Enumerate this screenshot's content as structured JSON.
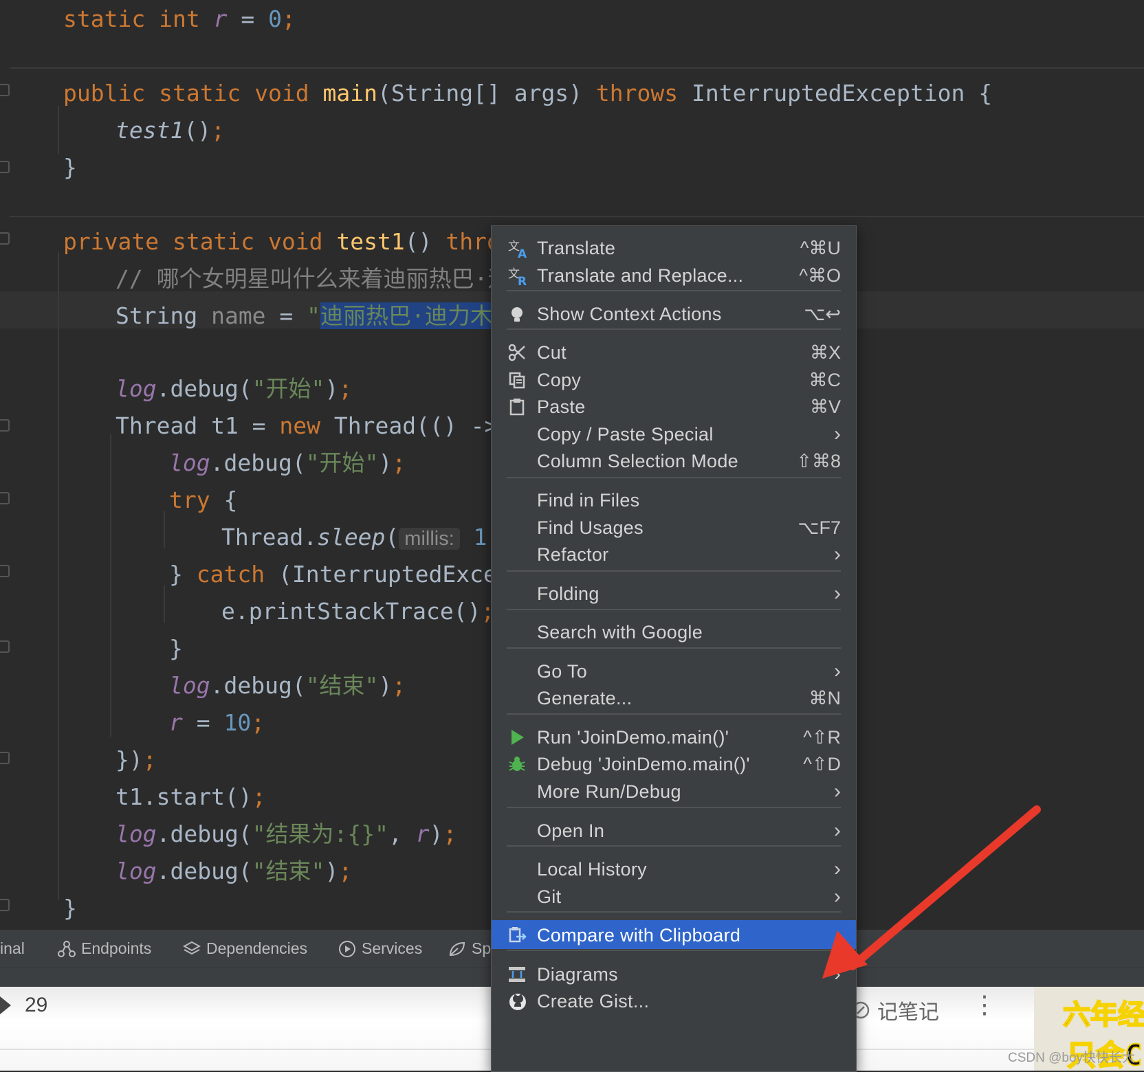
{
  "editor": {
    "lines": [
      {
        "tokens": [
          {
            "t": "static",
            "c": "kw"
          },
          {
            "t": " "
          },
          {
            "t": "int",
            "c": "kw"
          },
          {
            "t": " "
          },
          {
            "t": "r",
            "c": "fld"
          },
          {
            "t": " = "
          },
          {
            "t": "0",
            "c": "num"
          },
          {
            "t": ";",
            "c": "kw"
          }
        ]
      },
      {
        "tokens": [
          {
            "t": "public",
            "c": "kw"
          },
          {
            "t": " "
          },
          {
            "t": "static",
            "c": "kw"
          },
          {
            "t": " "
          },
          {
            "t": "void",
            "c": "kw"
          },
          {
            "t": " "
          },
          {
            "t": "main",
            "c": "fn"
          },
          {
            "t": "(String[] args) "
          },
          {
            "t": "throws",
            "c": "kw"
          },
          {
            "t": " InterruptedException {"
          }
        ]
      },
      {
        "tokens": [
          {
            "t": "test1",
            "c": "ital"
          },
          {
            "t": "()"
          },
          {
            "t": ";",
            "c": "kw"
          }
        ]
      },
      {
        "tokens": [
          {
            "t": "}"
          }
        ]
      },
      {
        "tokens": [
          {
            "t": "private",
            "c": "kw"
          },
          {
            "t": " "
          },
          {
            "t": "static",
            "c": "kw"
          },
          {
            "t": " "
          },
          {
            "t": "void",
            "c": "kw"
          },
          {
            "t": " "
          },
          {
            "t": "test1",
            "c": "fn"
          },
          {
            "t": "() "
          },
          {
            "t": "throw",
            "c": "kw"
          }
        ]
      },
      {
        "tokens": [
          {
            "t": "// 哪个女明星叫什么来着迪丽热巴·迪",
            "c": "cmt"
          }
        ]
      },
      {
        "tokens": [
          {
            "t": "String "
          },
          {
            "t": "name",
            "c": "unused"
          },
          {
            "t": " = "
          },
          {
            "t": "\"",
            "c": "str"
          },
          {
            "t": "迪丽热巴·迪力木拉",
            "c": "str sel"
          }
        ]
      },
      {
        "tokens": [
          {
            "t": "log",
            "c": "fld"
          },
          {
            "t": ".debug("
          },
          {
            "t": "\"开始\"",
            "c": "str"
          },
          {
            "t": ")"
          },
          {
            "t": ";",
            "c": "kw"
          }
        ]
      },
      {
        "tokens": [
          {
            "t": "Thread t1 = "
          },
          {
            "t": "new",
            "c": "kw"
          },
          {
            "t": " Thread(() ->"
          }
        ]
      },
      {
        "tokens": [
          {
            "t": "log",
            "c": "fld"
          },
          {
            "t": ".debug("
          },
          {
            "t": "\"开始\"",
            "c": "str"
          },
          {
            "t": ")"
          },
          {
            "t": ";",
            "c": "kw"
          }
        ]
      },
      {
        "tokens": [
          {
            "t": "try",
            "c": "kw"
          },
          {
            "t": " {"
          }
        ]
      },
      {
        "tokens": [
          {
            "t": "Thread."
          },
          {
            "t": "sleep",
            "c": "ital"
          },
          {
            "t": "("
          },
          {
            "t": "millis:",
            "c": "hint"
          },
          {
            "t": " "
          },
          {
            "t": "1",
            "c": "num"
          },
          {
            "t": ")"
          }
        ]
      },
      {
        "tokens": [
          {
            "t": "} "
          },
          {
            "t": "catch",
            "c": "kw"
          },
          {
            "t": " (InterruptedExcep"
          }
        ]
      },
      {
        "tokens": [
          {
            "t": "e.printStackTrace()"
          },
          {
            "t": ";",
            "c": "kw"
          }
        ]
      },
      {
        "tokens": [
          {
            "t": "}"
          }
        ]
      },
      {
        "tokens": [
          {
            "t": "log",
            "c": "fld"
          },
          {
            "t": ".debug("
          },
          {
            "t": "\"结束\"",
            "c": "str"
          },
          {
            "t": ")"
          },
          {
            "t": ";",
            "c": "kw"
          }
        ]
      },
      {
        "tokens": [
          {
            "t": "r",
            "c": "fld"
          },
          {
            "t": " = "
          },
          {
            "t": "10",
            "c": "num"
          },
          {
            "t": ";",
            "c": "kw"
          }
        ]
      },
      {
        "tokens": [
          {
            "t": "})"
          },
          {
            "t": ";",
            "c": "kw"
          }
        ]
      },
      {
        "tokens": [
          {
            "t": "t1.start()"
          },
          {
            "t": ";",
            "c": "kw"
          }
        ]
      },
      {
        "tokens": [
          {
            "t": "log",
            "c": "fld"
          },
          {
            "t": ".debug("
          },
          {
            "t": "\"结果为:{}\"",
            "c": "str"
          },
          {
            "t": ", "
          },
          {
            "t": "r",
            "c": "fld"
          },
          {
            "t": ")"
          },
          {
            "t": ";",
            "c": "kw"
          }
        ]
      },
      {
        "tokens": [
          {
            "t": "log",
            "c": "fld"
          },
          {
            "t": ".debug("
          },
          {
            "t": "\"结束\"",
            "c": "str"
          },
          {
            "t": ")"
          },
          {
            "t": ";",
            "c": "kw"
          }
        ]
      },
      {
        "tokens": [
          {
            "t": "}"
          }
        ]
      }
    ]
  },
  "tool_windows": {
    "terminal": "inal",
    "endpoints": "Endpoints",
    "dependencies": "Dependencies",
    "services": "Services",
    "spring": "Sp"
  },
  "context_menu": {
    "items": [
      {
        "id": "translate",
        "label": "Translate",
        "shortcut": "^⌘U",
        "icon": "translate-icon"
      },
      {
        "id": "translate-replace",
        "label": "Translate and Replace...",
        "shortcut": "^⌘O",
        "icon": "translate-replace-icon"
      },
      {
        "id": "show-context-actions",
        "label": "Show Context Actions",
        "shortcut": "⌥↩",
        "icon": "lightbulb-icon"
      },
      {
        "id": "cut",
        "label": "Cut",
        "shortcut": "⌘X",
        "icon": "scissors-icon"
      },
      {
        "id": "copy",
        "label": "Copy",
        "shortcut": "⌘C",
        "icon": "copy-icon"
      },
      {
        "id": "paste",
        "label": "Paste",
        "shortcut": "⌘V",
        "icon": "clipboard-icon"
      },
      {
        "id": "copy-paste-special",
        "label": "Copy / Paste Special",
        "submenu": true
      },
      {
        "id": "column-selection",
        "label": "Column Selection Mode",
        "shortcut": "⇧⌘8"
      },
      {
        "id": "find-in-files",
        "label": "Find in Files"
      },
      {
        "id": "find-usages",
        "label": "Find Usages",
        "shortcut": "⌥F7"
      },
      {
        "id": "refactor",
        "label": "Refactor",
        "submenu": true
      },
      {
        "id": "folding",
        "label": "Folding",
        "submenu": true
      },
      {
        "id": "search-google",
        "label": "Search with Google"
      },
      {
        "id": "go-to",
        "label": "Go To",
        "submenu": true
      },
      {
        "id": "generate",
        "label": "Generate...",
        "shortcut": "⌘N"
      },
      {
        "id": "run",
        "label": "Run 'JoinDemo.main()'",
        "shortcut": "^⇧R",
        "icon": "run-icon"
      },
      {
        "id": "debug",
        "label": "Debug 'JoinDemo.main()'",
        "shortcut": "^⇧D",
        "icon": "debug-bug-icon"
      },
      {
        "id": "more-run-debug",
        "label": "More Run/Debug",
        "submenu": true
      },
      {
        "id": "open-in",
        "label": "Open In",
        "submenu": true
      },
      {
        "id": "local-history",
        "label": "Local History",
        "submenu": true
      },
      {
        "id": "git",
        "label": "Git",
        "submenu": true
      },
      {
        "id": "compare-clipboard",
        "label": "Compare with Clipboard",
        "icon": "compare-clipboard-icon",
        "active": true
      },
      {
        "id": "diagrams",
        "label": "Diagrams",
        "submenu": true,
        "icon": "diagram-icon"
      },
      {
        "id": "create-gist",
        "label": "Create Gist...",
        "icon": "github-icon"
      }
    ]
  },
  "player": {
    "count": "29",
    "note_label": "记笔记",
    "more": "⋮"
  },
  "thumbnail": {
    "line1": "六年经",
    "line2": "只会C"
  },
  "watermark": "CSDN @boy快快长大",
  "colors": {
    "menu_active": "#2f65ca",
    "arrow": "#e8392b"
  }
}
